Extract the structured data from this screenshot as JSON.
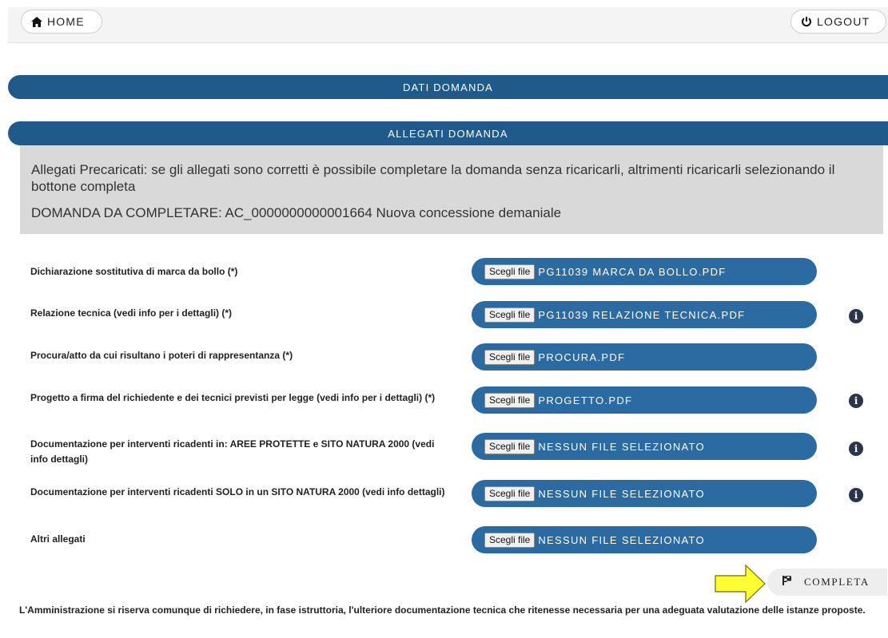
{
  "header": {
    "home_label": "HOME",
    "logout_label": "LOGOUT"
  },
  "sections": {
    "dati_title": "DATI DOMANDA",
    "allegati_title": "ALLEGATI DOMANDA"
  },
  "info": {
    "message": "Allegati Precaricati: se gli allegati sono corretti è possibile completare la domanda senza ricaricarli, altrimenti ricaricarli selezionando il bottone completa",
    "domanda": "DOMANDA DA COMPLETARE: AC_0000000000001664 Nuova concessione demaniale"
  },
  "attachments": [
    {
      "label": "Dichiarazione sostitutiva di marca da bollo (*)",
      "button": "Scegli file",
      "file": "PG11039 MARCA DA BOLLO.PDF",
      "info": false
    },
    {
      "label": "Relazione tecnica (vedi info per i dettagli) (*)",
      "button": "Scegli file",
      "file": "PG11039 RELAZIONE TECNICA.PDF",
      "info": true
    },
    {
      "label": "Procura/atto da cui risultano i poteri di rappresentanza (*)",
      "button": "Scegli file",
      "file": "PROCURA.PDF",
      "info": false
    },
    {
      "label": "Progetto a firma del richiedente e dei tecnici previsti per legge (vedi info per i dettagli) (*)",
      "button": "Scegli file",
      "file": "PROGETTO.PDF",
      "info": true
    },
    {
      "label": "Documentazione per interventi ricadenti in: AREE PROTETTE e SITO NATURA 2000 (vedi info dettagli)",
      "button": "Scegli file",
      "file": "NESSUN FILE SELEZIONATO",
      "info": true
    },
    {
      "label": "Documentazione per interventi ricadenti SOLO in un SITO NATURA 2000 (vedi info dettagli)",
      "button": "Scegli file",
      "file": "NESSUN FILE SELEZIONATO",
      "info": true
    },
    {
      "label": "Altri allegati",
      "button": "Scegli file",
      "file": "NESSUN FILE SELEZIONATO",
      "info": false
    }
  ],
  "actions": {
    "completa_label": "COMPLETA"
  },
  "footer": {
    "note": "L'Amministrazione si riserva comunque di richiedere, in fase istruttoria, l'ulteriore documentazione tecnica che ritenesse necessaria per una adeguata valutazione delle istanze proposte."
  },
  "colors": {
    "section_bar": "#1f5a8a",
    "file_pill": "#2c6aa2",
    "info_panel": "#d9d9d9",
    "annotation_arrow": "#ffff33"
  },
  "icons": {
    "home": "home-icon",
    "logout": "power-icon",
    "info": "info-icon",
    "completa": "flag-icon"
  }
}
